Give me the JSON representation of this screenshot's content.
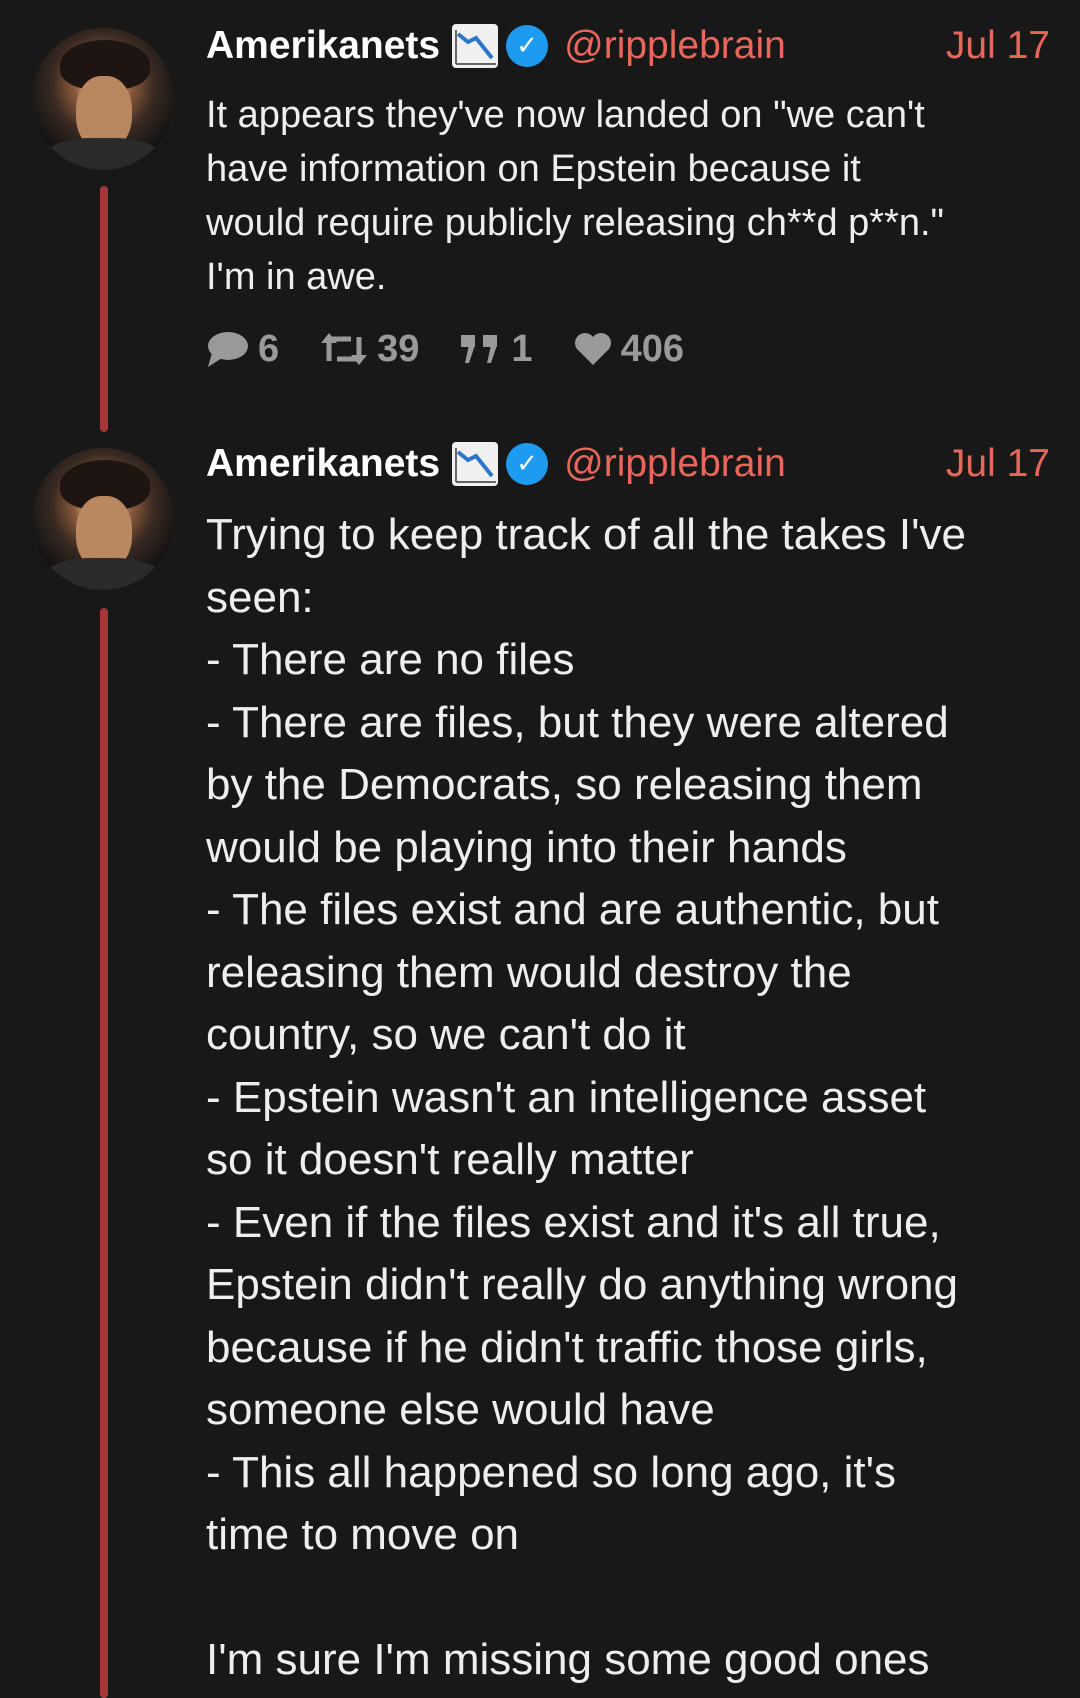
{
  "posts": [
    {
      "author_name": "Amerikanets",
      "author_emoji_icon": "chart-decreasing-icon",
      "verified_icon": "verified-badge-icon",
      "handle": "@ripplebrain",
      "date": "Jul 17",
      "text": "It appears they've now landed on \"we can't\nhave information on Epstein because it\nwould require publicly releasing ch**d p**n.\"\nI'm in awe.",
      "stats": {
        "replies": "6",
        "reposts": "39",
        "quotes": "1",
        "likes": "406"
      }
    },
    {
      "author_name": "Amerikanets",
      "author_emoji_icon": "chart-decreasing-icon",
      "verified_icon": "verified-badge-icon",
      "handle": "@ripplebrain",
      "date": "Jul 17",
      "text": "Trying to keep track of all the takes I've\nseen:\n- There are no files\n- There are files, but they were altered\nby the Democrats, so releasing them\nwould be playing into their hands\n- The files exist and are authentic, but\nreleasing them would destroy the\ncountry, so we can't do it\n- Epstein wasn't an intelligence asset\nso it doesn't really matter\n- Even if the files exist and it's all true,\nEpstein didn't really do anything wrong\nbecause if he didn't traffic those girls,\nsomeone else would have\n- This all happened so long ago, it's\ntime to move on\n\nI'm sure I'm missing some good ones"
    }
  ],
  "colors": {
    "background": "#181818",
    "accent": "#e8675b",
    "thread_line": "#a83838",
    "verified": "#1d9bf0",
    "stats": "#9a9a9a"
  }
}
